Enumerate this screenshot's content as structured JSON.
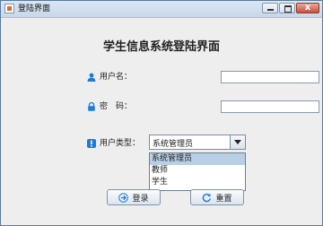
{
  "window": {
    "title": "登陆界面",
    "icon": "java-app-icon",
    "controls": [
      "minimize-icon",
      "maximize-icon",
      "close-icon"
    ],
    "close_glyph": "x"
  },
  "form": {
    "heading": "学生信息系统登陆界面",
    "username": {
      "label": "用户名：",
      "icon": "user-icon",
      "value": ""
    },
    "password": {
      "label": "密　码：",
      "icon": "lock-icon",
      "value": ""
    },
    "user_type": {
      "label": "用户类型：",
      "icon": "info-icon",
      "selected": "系统管理员",
      "options": [
        "系统管理员",
        "教师",
        "学生"
      ],
      "highlighted_index": 0
    }
  },
  "buttons": {
    "login": {
      "label": "登录",
      "icon": "login-arrow-icon"
    },
    "reset": {
      "label": "重置",
      "icon": "refresh-icon"
    }
  },
  "colors": {
    "icon_blue": "#1e7bd8",
    "highlight": "#b8cfe5"
  }
}
